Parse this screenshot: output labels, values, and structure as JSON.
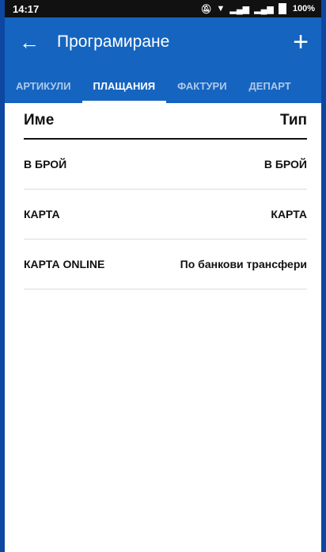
{
  "status_bar": {
    "time": "14:17",
    "icons": [
      "mute-icon",
      "wifi-icon",
      "signal-icon",
      "signal-icon"
    ],
    "battery": "100%"
  },
  "app_bar": {
    "title": "Програмиране",
    "back_icon": "arrow-left-icon",
    "add_icon": "plus-icon"
  },
  "tabs": [
    {
      "label": "АРТИКУЛИ",
      "active": false
    },
    {
      "label": "ПЛАЩАНИЯ",
      "active": true
    },
    {
      "label": "ФАКТУРИ",
      "active": false
    },
    {
      "label": "ДЕПАРТ",
      "active": false
    }
  ],
  "table": {
    "headers": {
      "name": "Име",
      "type": "Тип"
    },
    "rows": [
      {
        "name": "В БРОЙ",
        "type": "В БРОЙ"
      },
      {
        "name": "КАРТА",
        "type": "КАРТА"
      },
      {
        "name": "КАРТА ONLINE",
        "type": "По банкови трансфери"
      }
    ]
  },
  "colors": {
    "primary": "#1564c0",
    "frame": "#0d47a1",
    "status_bar": "#111111"
  }
}
